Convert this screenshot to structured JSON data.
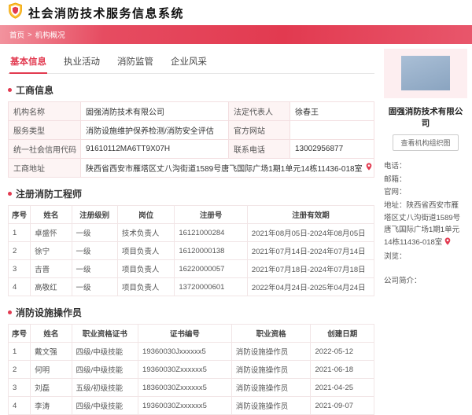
{
  "header": {
    "title": "社会消防技术服务信息系统"
  },
  "breadcrumb": {
    "home": "首页",
    "separator": ">",
    "current": "机构概况"
  },
  "tabs": [
    {
      "label": "基本信息"
    },
    {
      "label": "执业活动"
    },
    {
      "label": "消防监管"
    },
    {
      "label": "企业风采"
    }
  ],
  "business_info": {
    "title": "工商信息",
    "name_label": "机构名称",
    "name_value": "固强消防技术有限公司",
    "legal_label": "法定代表人",
    "legal_value": "徐春王",
    "type_label": "服务类型",
    "type_value": "消防设施维护保养检测/消防安全评估",
    "website_label": "官方网站",
    "website_value": "",
    "credit_label": "统一社会信用代码",
    "credit_value": "91610112MA6TT9X07H",
    "phone_label": "联系电话",
    "phone_value": "13002956877",
    "address_label": "工商地址",
    "address_value": "陕西省西安市雁塔区丈八沟街道1589号唐飞国际广场1期1单元14栋11436-018室"
  },
  "engineers": {
    "title": "注册消防工程师",
    "columns": [
      "序号",
      "姓名",
      "注册级别",
      "岗位",
      "注册号",
      "注册有效期"
    ],
    "rows": [
      [
        "1",
        "卓盛怀",
        "一级",
        "技术负责人",
        "16121000284",
        "2021年08月05日-2024年08月05日"
      ],
      [
        "2",
        "徐宁",
        "一级",
        "项目负责人",
        "16120000138",
        "2021年07月14日-2024年07月14日"
      ],
      [
        "3",
        "吉晋",
        "一级",
        "项目负责人",
        "16220000057",
        "2021年07月18日-2024年07月18日"
      ],
      [
        "4",
        "高敬红",
        "一级",
        "项目负责人",
        "13720000601",
        "2022年04月24日-2025年04月24日"
      ]
    ]
  },
  "operators": {
    "title": "消防设施操作员",
    "columns": [
      "序号",
      "姓名",
      "职业资格证书",
      "证书编号",
      "职业资格",
      "创建日期"
    ],
    "rows": [
      [
        "1",
        "戴文强",
        "四级/中级技能",
        "19360030Jxxxxxx5",
        "消防设施操作员",
        "2022-05-12"
      ],
      [
        "2",
        "何明",
        "四级/中级技能",
        "19360030Zxxxxxx5",
        "消防设施操作员",
        "2021-06-18"
      ],
      [
        "3",
        "刘磊",
        "五级/初级技能",
        "18360030Zxxxxxx5",
        "消防设施操作员",
        "2021-04-25"
      ],
      [
        "4",
        "李涛",
        "四级/中级技能",
        "19360030Zxxxxxx5",
        "消防设施操作员",
        "2021-09-07"
      ]
    ]
  },
  "sidebar": {
    "company_name": "固强消防技术有限公司",
    "org_chart_button": "查看机构组织图",
    "contact": {
      "phone_label": "电话：",
      "phone_value": "",
      "email_label": "邮箱：",
      "email_value": "",
      "website_label": "官网：",
      "website_value": "",
      "address_label": "地址：",
      "address_value": "陕西省西安市雁塔区丈八沟街道1589号唐飞国际广场1期1单元14栋11436-018室",
      "views_label": "浏览：",
      "views_value": "",
      "profile_label": "公司简介：",
      "profile_value": ""
    }
  },
  "colors": {
    "accent": "#e23a50",
    "banner": "#e64057",
    "label_bg": "#fdf4f4",
    "card_bg": "#fdeef0",
    "photo_bg": "#94abc4"
  }
}
